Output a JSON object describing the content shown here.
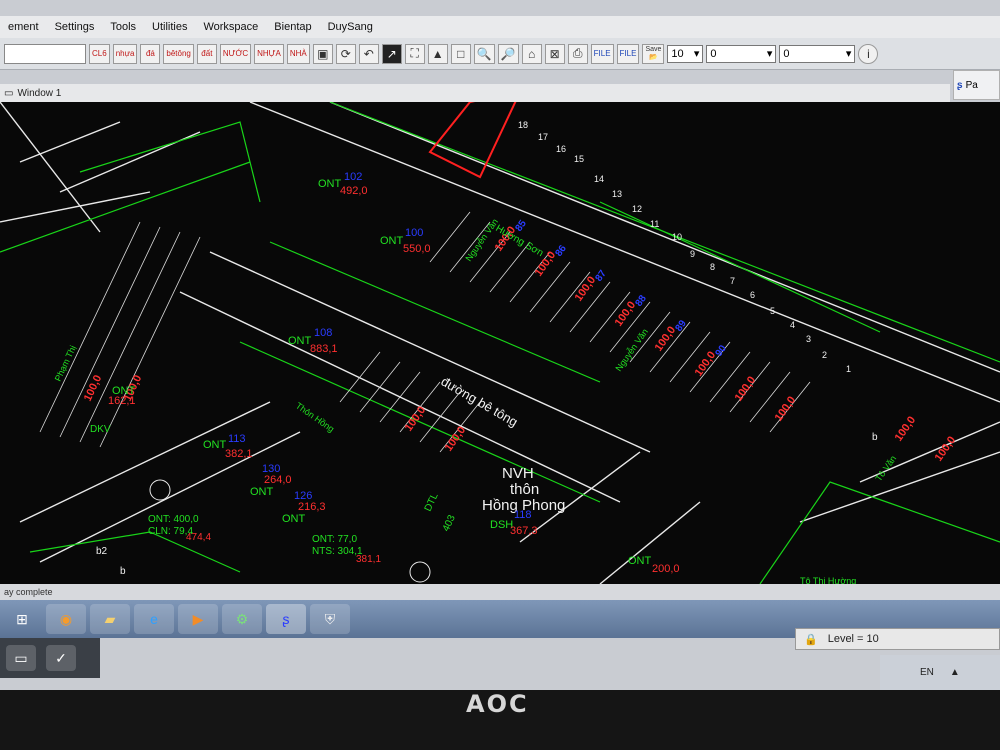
{
  "menu": {
    "items": [
      "ement",
      "Settings",
      "Tools",
      "Utilities",
      "Workspace",
      "Bientap",
      "DuySang"
    ]
  },
  "toolbar": {
    "buttons": [
      "CL6",
      "nhựa",
      "đá",
      "bêtông",
      "đất",
      "NƯỚC",
      "NHỰA",
      "NHÀ"
    ],
    "file_buttons": [
      "FILE",
      "FILE"
    ],
    "save_label": "Save",
    "weight_value": "10",
    "style_value": "0",
    "width_value": "0"
  },
  "window": {
    "title": "Window 1"
  },
  "side_panel": {
    "label": "Pa"
  },
  "map": {
    "road_labels": [
      "đường bê tông",
      "Hương Sơn",
      "Thôn Hồng"
    ],
    "center_label": [
      "NVH",
      "thôn",
      "Hồng Phong"
    ],
    "center_dsh": "DSH",
    "center_number": "118",
    "center_area": "367,3",
    "parcels": [
      {
        "code": "ONT",
        "num": "102",
        "area": "492,0"
      },
      {
        "code": "ONT",
        "num": "100",
        "area": "550,0"
      },
      {
        "code": "ONT",
        "num": "108",
        "area": "883,1"
      },
      {
        "code": "ONT",
        "num": "113",
        "area": "382,1"
      },
      {
        "code": "ONT",
        "num": "130",
        "area": "264,0"
      },
      {
        "code": "ONT",
        "num": "126",
        "area": "216,3"
      },
      {
        "code": "ONT",
        "num": "",
        "area": "162,1"
      },
      {
        "code": "ONT",
        "num": "",
        "area": "200,0"
      }
    ],
    "ont_mix": [
      "ONT: 400,0",
      "CLN: 79,4",
      "474,4"
    ],
    "nts_mix": [
      "ONT: 77,0",
      "NTS: 304,1",
      "381,1"
    ],
    "numbers": [
      "18",
      "17",
      "16",
      "15",
      "14",
      "13",
      "12",
      "11",
      "10",
      "9",
      "8",
      "7",
      "6",
      "5",
      "4",
      "3",
      "2",
      "1"
    ],
    "owner": "Tô Thị Hường",
    "misc": [
      "b2",
      "b",
      "DTL",
      "403",
      "DKV",
      "b"
    ]
  },
  "status": {
    "text": "ay complete"
  },
  "level": {
    "label": "Level = 10"
  },
  "tray": {
    "lang": "EN"
  },
  "brand": "AOC"
}
